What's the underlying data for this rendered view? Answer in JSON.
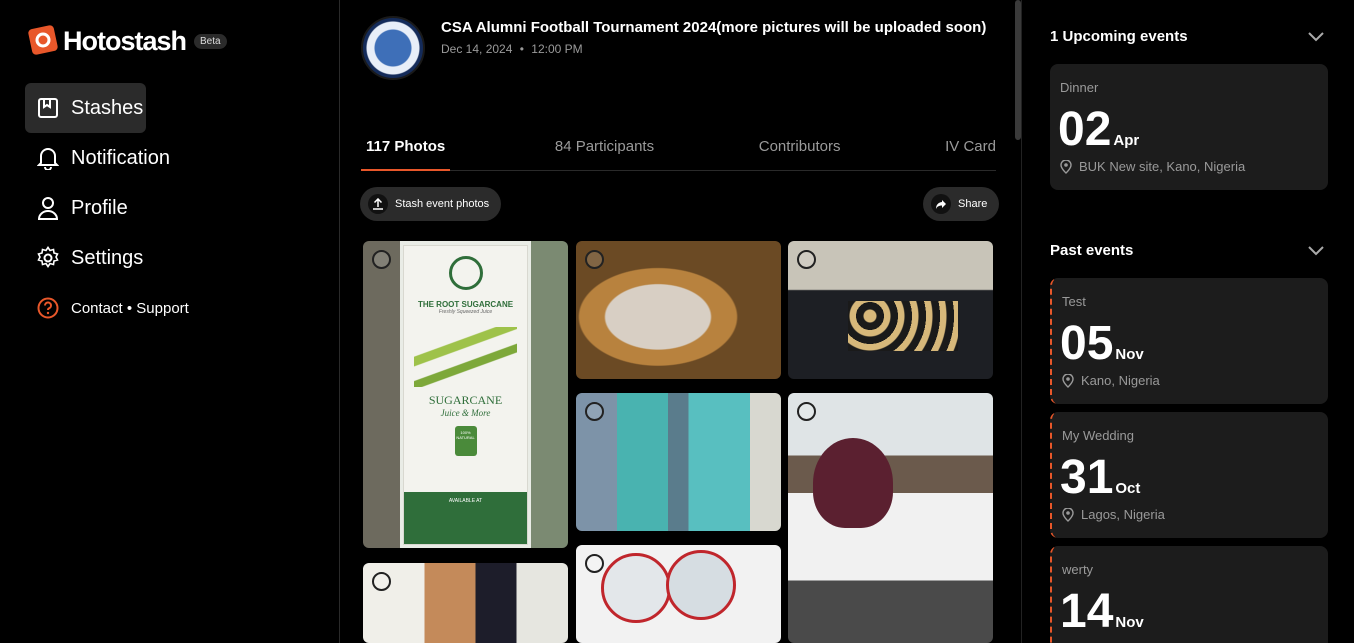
{
  "brand": {
    "name": "Hotostash",
    "badge": "Beta",
    "accent": "#e8572a"
  },
  "nav": {
    "items": [
      {
        "label": "Stashes",
        "icon": "stash-icon"
      },
      {
        "label": "Notification",
        "icon": "bell-icon"
      },
      {
        "label": "Profile",
        "icon": "user-icon"
      },
      {
        "label": "Settings",
        "icon": "gear-icon"
      }
    ],
    "support": {
      "label": "Contact • Support",
      "icon": "help-icon"
    }
  },
  "event": {
    "title": "CSA Alumni Football Tournament 2024(more pictures will be uploaded soon)",
    "date": "Dec 14, 2024",
    "separator": "•",
    "time": "12:00 PM"
  },
  "tabs": [
    {
      "label": "117 Photos",
      "active": true
    },
    {
      "label": "84 Participants",
      "active": false
    },
    {
      "label": "Contributors",
      "active": false
    },
    {
      "label": "IV Card",
      "active": false
    }
  ],
  "actions": {
    "upload_label": "Stash event photos",
    "share_label": "Share"
  },
  "photos": [
    {
      "name": "photo-sugarcane-banner",
      "caption": "THE ROOT SUGARCANE",
      "subcaption": "Freshly Squeezed Juice",
      "headline": "SUGARCANE",
      "tagline": "Juice & More",
      "badge": "100% NATURAL",
      "footer": "AVAILABLE AT"
    },
    {
      "name": "photo-juice-cups"
    },
    {
      "name": "photo-pancakes"
    },
    {
      "name": "photo-crowd-aia"
    },
    {
      "name": "photo-woman-vendor"
    },
    {
      "name": "photo-smiling-women"
    },
    {
      "name": "photo-posters"
    }
  ],
  "upcoming": {
    "title": "1 Upcoming events",
    "events": [
      {
        "name": "Dinner",
        "day": "02",
        "month": "Apr",
        "location": "BUK New site, Kano, Nigeria"
      }
    ]
  },
  "past": {
    "title": "Past events",
    "events": [
      {
        "name": "Test",
        "day": "05",
        "month": "Nov",
        "location": "Kano, Nigeria"
      },
      {
        "name": "My Wedding",
        "day": "31",
        "month": "Oct",
        "location": "Lagos, Nigeria"
      },
      {
        "name": "werty",
        "day": "14",
        "month": "Nov",
        "location": ""
      }
    ]
  }
}
